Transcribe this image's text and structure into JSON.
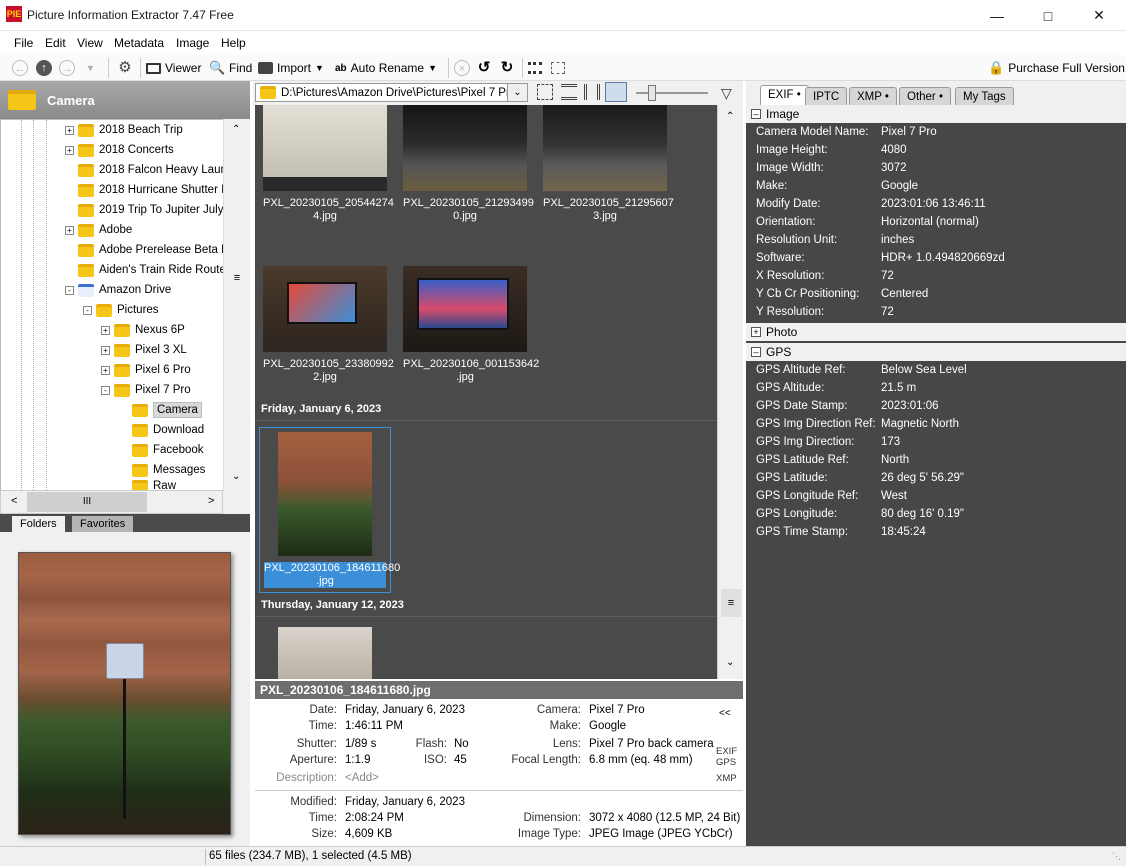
{
  "window": {
    "title": "Picture Information Extractor 7.47 Free",
    "icon": "PIE"
  },
  "menu": [
    "File",
    "Edit",
    "View",
    "Metadata",
    "Image",
    "Help"
  ],
  "toolbar": {
    "viewer": "Viewer",
    "find": "Find",
    "import": "Import",
    "auto_rename": "Auto Rename",
    "purchase": "Purchase Full Version"
  },
  "folders": {
    "header": "Camera",
    "items": [
      {
        "label": "2018 Beach Trip",
        "expand": "+"
      },
      {
        "label": "2018 Concerts",
        "expand": "+"
      },
      {
        "label": "2018 Falcon Heavy Launc",
        "expand": ""
      },
      {
        "label": "2018 Hurricane Shutter In",
        "expand": ""
      },
      {
        "label": "2019 Trip To Jupiter July 2",
        "expand": ""
      },
      {
        "label": "Adobe",
        "expand": "+"
      },
      {
        "label": "Adobe Prerelease Beta F",
        "expand": ""
      },
      {
        "label": "Aiden's Train Ride Route",
        "expand": ""
      },
      {
        "label": "Amazon Drive",
        "expand": "-"
      },
      {
        "label": "Pictures",
        "expand": "-"
      },
      {
        "label": "Nexus 6P",
        "expand": "+"
      },
      {
        "label": "Pixel 3 XL",
        "expand": "+"
      },
      {
        "label": "Pixel 6 Pro",
        "expand": "+"
      },
      {
        "label": "Pixel 7 Pro",
        "expand": "-"
      },
      {
        "label": "Camera",
        "expand": ""
      },
      {
        "label": "Download",
        "expand": ""
      },
      {
        "label": "Facebook",
        "expand": ""
      },
      {
        "label": "Messages",
        "expand": ""
      },
      {
        "label": "Raw",
        "expand": ""
      }
    ],
    "tabs": [
      "Folders",
      "Favorites"
    ]
  },
  "path": "D:\\Pictures\\Amazon Drive\\Pictures\\Pixel 7 Pro",
  "thumbs": [
    {
      "name": "PXL_20230105_20544274\n4.jpg"
    },
    {
      "name": "PXL_20230105_21293499\n0.jpg"
    },
    {
      "name": "PXL_20230105_21295607\n3.jpg"
    },
    {
      "name": "PXL_20230105_23380992\n2.jpg"
    },
    {
      "name": "PXL_20230106_001153642\n.jpg"
    },
    {
      "name": "PXL_20230106_184611680\n.jpg"
    }
  ],
  "groups": {
    "jan6": "Friday, January 6, 2023",
    "jan12": "Thursday, January 12, 2023"
  },
  "info": {
    "filename": "PXL_20230106_184611680.jpg",
    "date_l": "Date:",
    "date": "Friday, January 6, 2023",
    "time_l": "Time:",
    "time": "1:46:11 PM",
    "shutter_l": "Shutter:",
    "shutter": "1/89 s",
    "flash_l": "Flash:",
    "flash": "No",
    "aperture_l": "Aperture:",
    "aperture": "1:1.9",
    "iso_l": "ISO:",
    "iso": "45",
    "desc_l": "Description:",
    "desc": "<Add>",
    "camera_l": "Camera:",
    "camera": "Pixel 7 Pro",
    "make_l": "Make:",
    "make": "Google",
    "lens_l": "Lens:",
    "lens": "Pixel 7 Pro back camera",
    "focal_l": "Focal Length:",
    "focal": "6.8 mm (eq. 48 mm)",
    "collapse": "<<",
    "exif": "EXIF",
    "gps": "GPS",
    "xmp": "XMP",
    "modified_l": "Modified:",
    "modified": "Friday, January 6, 2023",
    "mtime_l": "Time:",
    "mtime": "2:08:24 PM",
    "size_l": "Size:",
    "size": "4,609 KB",
    "dim_l": "Dimension:",
    "dim": "3072 x 4080 (12.5 MP, 24 Bit)",
    "type_l": "Image Type:",
    "type": "JPEG Image (JPEG YCbCr)"
  },
  "rtabs": [
    "EXIF •",
    "IPTC",
    "XMP •",
    "Other •",
    "My Tags"
  ],
  "image_section": "Image",
  "image_rows": [
    [
      "Camera Model Name:",
      "Pixel 7 Pro"
    ],
    [
      "Image Height:",
      "4080"
    ],
    [
      "Image Width:",
      "3072"
    ],
    [
      "Make:",
      "Google"
    ],
    [
      "Modify Date:",
      "2023:01:06 13:46:11"
    ],
    [
      "Orientation:",
      "Horizontal (normal)"
    ],
    [
      "Resolution Unit:",
      "inches"
    ],
    [
      "Software:",
      "HDR+ 1.0.494820669zd"
    ],
    [
      "X Resolution:",
      "72"
    ],
    [
      "Y Cb Cr Positioning:",
      "Centered"
    ],
    [
      "Y Resolution:",
      "72"
    ]
  ],
  "photo_section": "Photo",
  "gps_section": "GPS",
  "gps_rows": [
    [
      "GPS Altitude Ref:",
      "Below Sea Level"
    ],
    [
      "GPS Altitude:",
      "21.5 m"
    ],
    [
      "GPS Date Stamp:",
      "2023:01:06"
    ],
    [
      "GPS Img Direction Ref:",
      "Magnetic North"
    ],
    [
      "GPS Img Direction:",
      "173"
    ],
    [
      "GPS Latitude Ref:",
      "North"
    ],
    [
      "GPS Latitude:",
      "26 deg 5' 56.29\""
    ],
    [
      "GPS Longitude Ref:",
      "West"
    ],
    [
      "GPS Longitude:",
      "80 deg 16' 0.19\""
    ],
    [
      "GPS Time Stamp:",
      "18:45:24"
    ]
  ],
  "status": "65 files (234.7 MB), 1 selected (4.5 MB)"
}
